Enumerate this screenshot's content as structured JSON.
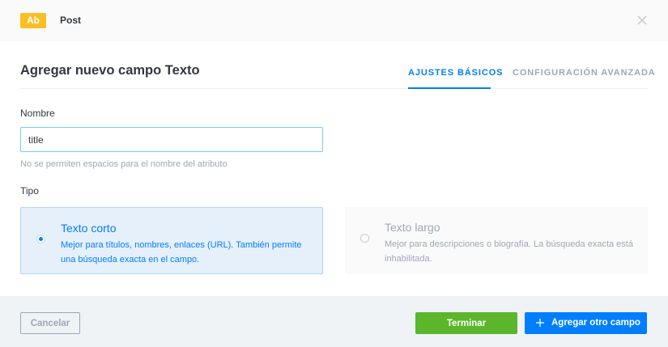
{
  "header": {
    "badge": "Ab",
    "content_type": "Post",
    "close_icon": "close-icon"
  },
  "modal": {
    "title": "Agregar nuevo campo Texto",
    "tabs": [
      {
        "label": "AJUSTES BÁSICOS",
        "active": true
      },
      {
        "label": "CONFIGURACIÓN AVANZADA",
        "active": false
      }
    ]
  },
  "form": {
    "name_label": "Nombre",
    "name_value": "title",
    "name_hint": "No se permiten espacios para el nombre del atributo",
    "type_label": "Tipo",
    "type_options": [
      {
        "title": "Texto corto",
        "description": "Mejor para títulos, nombres, enlaces (URL). También permite una búsqueda exacta en el campo.",
        "selected": true
      },
      {
        "title": "Texto largo",
        "description": "Mejor para descripciones o biografía. La búsqueda exacta está inhabilitada.",
        "selected": false
      }
    ]
  },
  "footer": {
    "cancel_label": "Cancelar",
    "finish_label": "Terminar",
    "add_label": "Agregar otro campo",
    "add_icon": "plus-icon"
  },
  "colors": {
    "accent": "#007eff",
    "success": "#5cb62b",
    "badge": "#fbbf24",
    "muted": "#9ea7b8"
  }
}
